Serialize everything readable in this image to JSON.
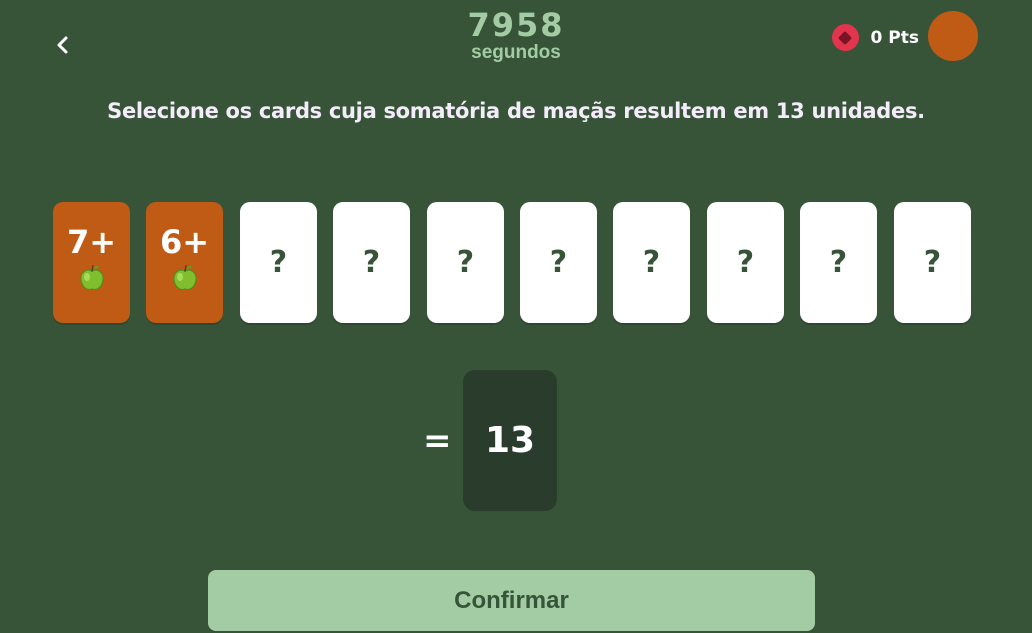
{
  "header": {
    "timer_value": "7958",
    "timer_unit": "segundos",
    "points_label": "0 Pts",
    "back_icon": "chevron-left-icon",
    "points_icon": "gem-icon"
  },
  "instruction": "Selecione os cards cuja somatória de maçãs resultem em 13 unidades.",
  "cards": [
    {
      "state": "revealed",
      "label": "7+",
      "icon": "green-apple-icon"
    },
    {
      "state": "revealed",
      "label": "6+",
      "icon": "green-apple-icon"
    },
    {
      "state": "hidden",
      "label": "?"
    },
    {
      "state": "hidden",
      "label": "?"
    },
    {
      "state": "hidden",
      "label": "?"
    },
    {
      "state": "hidden",
      "label": "?"
    },
    {
      "state": "hidden",
      "label": "?"
    },
    {
      "state": "hidden",
      "label": "?"
    },
    {
      "state": "hidden",
      "label": "?"
    },
    {
      "state": "hidden",
      "label": "?"
    }
  ],
  "equation": {
    "equals_sign": "=",
    "target": "13"
  },
  "confirm_label": "Confirmar",
  "colors": {
    "background": "#375438",
    "accent_light": "#a3cca5",
    "card_revealed": "#c05b16",
    "card_hidden": "#ffffff",
    "result_box": "#2a3c2c",
    "points_icon": "#e2344d"
  }
}
